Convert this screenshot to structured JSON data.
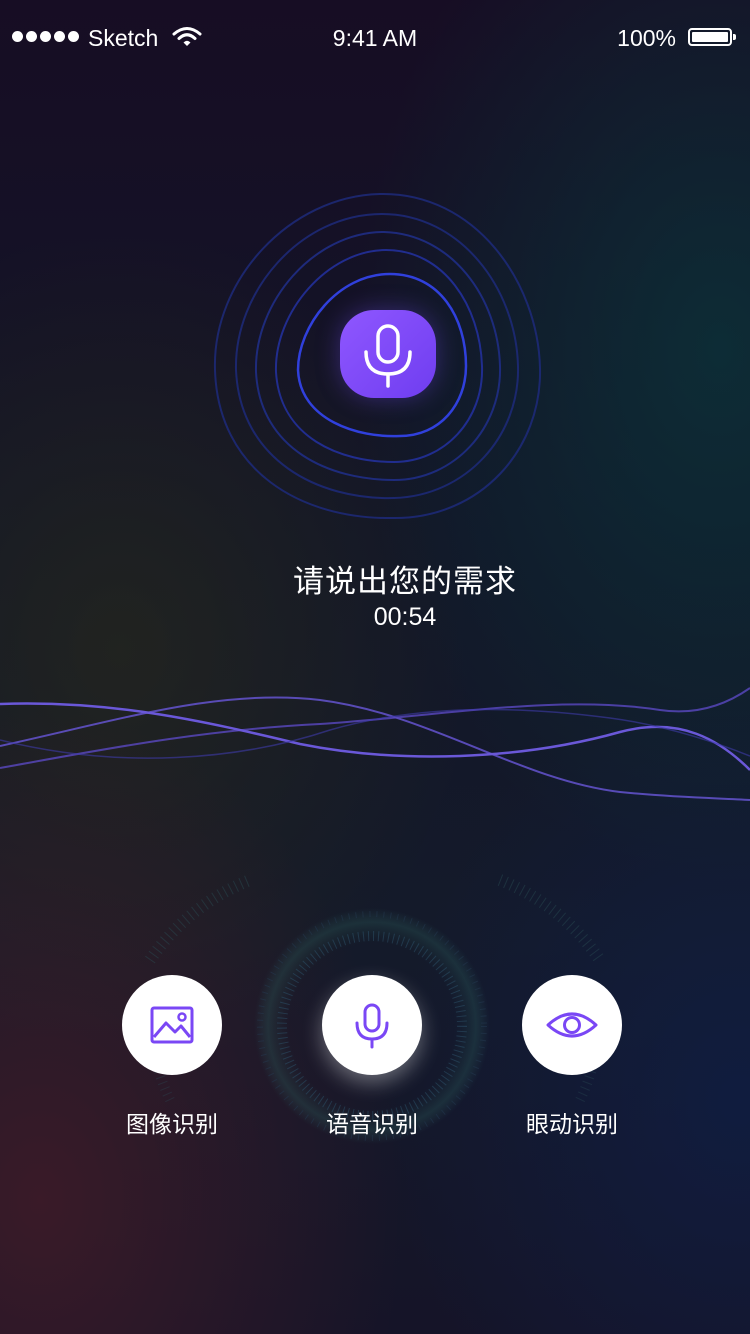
{
  "status_bar": {
    "carrier": "Sketch",
    "time": "9:41 AM",
    "battery_percent": "100%",
    "battery_level": 1.0,
    "signal_bars": 5
  },
  "voice": {
    "prompt": "请说出您的需求",
    "timer": "00:54",
    "mic_icon": "microphone-icon"
  },
  "actions": [
    {
      "label": "图像识别",
      "icon": "image-icon",
      "active": false
    },
    {
      "label": "语音识别",
      "icon": "microphone-icon",
      "active": true
    },
    {
      "label": "眼动识别",
      "icon": "eye-icon",
      "active": false
    }
  ],
  "colors": {
    "accent_purple": "#7a47f5",
    "ring_blue": "#2f3cd6",
    "wave_purple": "#6a55d8",
    "text": "#ffffff"
  }
}
